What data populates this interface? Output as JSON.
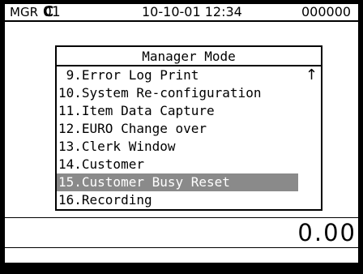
{
  "status_bar": {
    "mode": "MGR",
    "clerk_prefix": "C",
    "clerk_number": "01",
    "datetime": "10-10-01 12:34",
    "counter": "000000"
  },
  "menu": {
    "title": "Manager Mode",
    "scroll_icon": "up-arrow-icon",
    "items": [
      {
        "label": " 9.Error Log Print",
        "selected": false
      },
      {
        "label": "10.System Re-configuration",
        "selected": false
      },
      {
        "label": "11.Item Data Capture",
        "selected": false
      },
      {
        "label": "12.EURO Change over",
        "selected": false
      },
      {
        "label": "13.Clerk Window",
        "selected": false
      },
      {
        "label": "14.Customer",
        "selected": false
      },
      {
        "label": "15.Customer Busy Reset",
        "selected": true
      },
      {
        "label": "16.Recording",
        "selected": false
      }
    ]
  },
  "display": {
    "amount": "0.00"
  },
  "colors": {
    "highlight": "#8a8a8a",
    "text": "#000000",
    "background": "#ffffff"
  }
}
